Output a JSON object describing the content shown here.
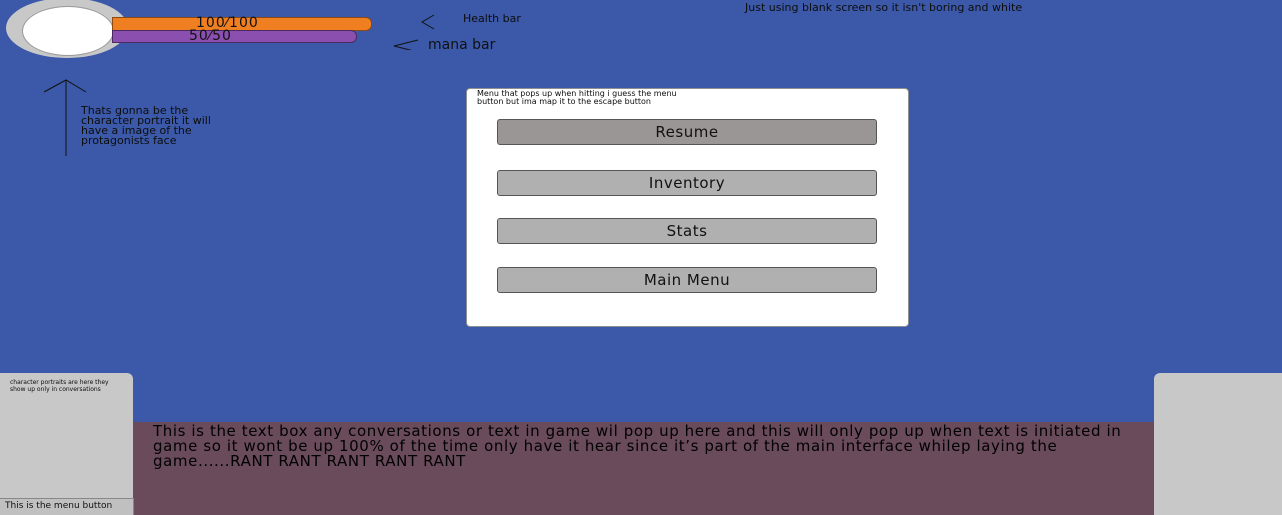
{
  "hud": {
    "health_text": "100⁄100",
    "mana_text": "50⁄50",
    "health_fraction": 1.0,
    "mana_fraction": 1.0,
    "health_color": "#f07f22",
    "mana_color": "#8b4fb0"
  },
  "annotations": {
    "health_bar": "Health bar",
    "mana_bar": "mana bar",
    "background": "Just using blank screen so it isn't boring and white",
    "portrait": "Thats gonna be the character portrait it will have a image of the protagonists face",
    "menu": "Menu that pops up when hitting i guess the menu button but ima map it to the escape button",
    "conversation_portraits": "character portraits are here they show up only in conversations"
  },
  "menu": {
    "items": [
      {
        "label": "Resume",
        "selected": true
      },
      {
        "label": "Inventory",
        "selected": false
      },
      {
        "label": "Stats",
        "selected": false
      },
      {
        "label": "Main Menu",
        "selected": false
      }
    ]
  },
  "text_box": {
    "content": "This is the text box any conversations or text in game wil pop up here and this will only pop up when text is initiated in game so it wont be up 100% of the time only have it hear since it’s part of the main interface whilep laying the game......RANT RANT RANT RANT RANT"
  },
  "menu_button": {
    "label": "This is the menu button"
  },
  "colors": {
    "background": "#3b59a8",
    "panel": "#ffffff",
    "button": "#b0b0b0",
    "text_box": "#6a4b5c",
    "portrait_frame": "#c9c8c8"
  }
}
